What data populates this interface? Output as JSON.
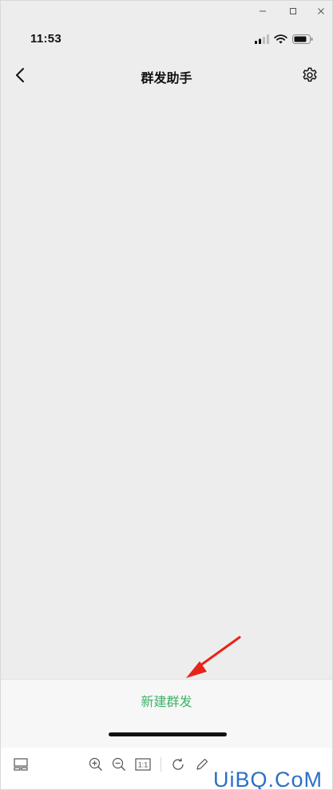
{
  "status": {
    "time": "11:53"
  },
  "nav": {
    "title": "群发助手"
  },
  "bottom": {
    "new_broadcast_label": "新建群发"
  },
  "toolbar": {
    "actual_size_label": "1:1"
  },
  "watermark": {
    "text": "UiBQ.CoM"
  },
  "colors": {
    "accent_green": "#3fb268",
    "annotation_red": "#e8231a",
    "background": "#ededed",
    "watermark_blue": "#2c6fc6"
  },
  "icons": [
    "minimize-icon",
    "maximize-icon",
    "close-icon",
    "signal-icon",
    "wifi-icon",
    "battery-icon",
    "back-chevron-icon",
    "settings-gear-icon",
    "thumbnail-layout-icon",
    "zoom-in-icon",
    "zoom-out-icon",
    "rotate-icon",
    "edit-pen-icon",
    "red-arrow-icon"
  ]
}
